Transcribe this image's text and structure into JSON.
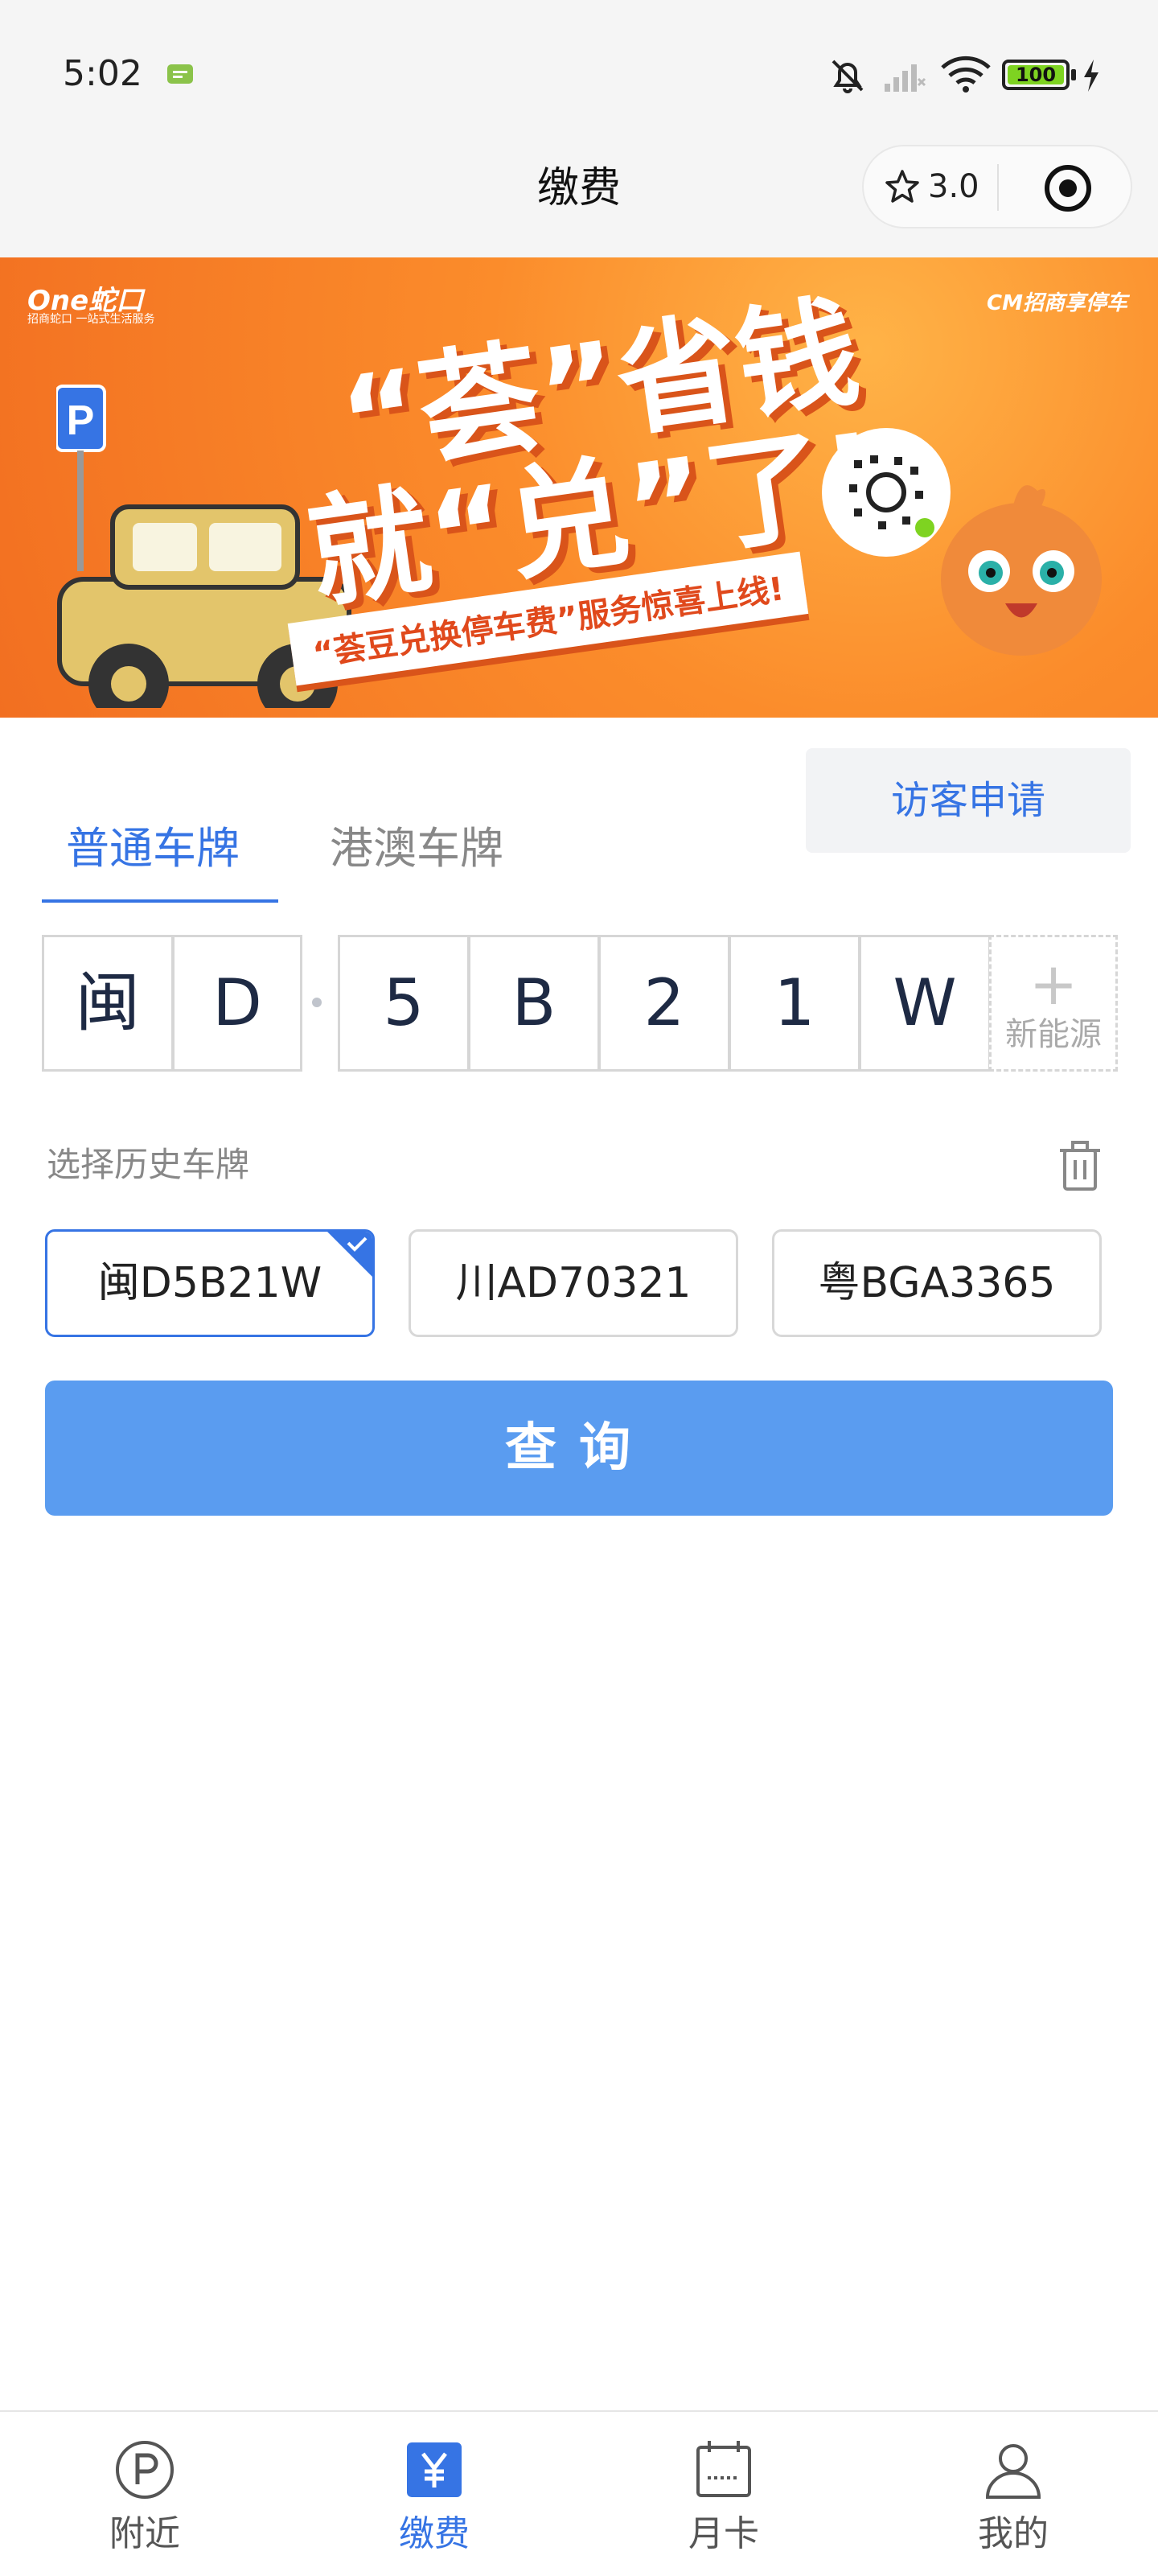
{
  "status_bar": {
    "time": "5:02",
    "battery": "100",
    "icons": [
      "message-icon",
      "mute-icon",
      "signal-icon",
      "wifi-icon",
      "battery-icon",
      "charging-icon"
    ]
  },
  "nav": {
    "title": "缴费",
    "rating": "3.0"
  },
  "banner": {
    "brand": "One蛇口",
    "brand_sub": "招商蛇口 一站式生活服务",
    "logo": "CM招商享停车",
    "headline_1": "“荟”省钱",
    "headline_2": "就“兑”了!",
    "ribbon": "“荟豆兑换停车费”服务惊喜上线!",
    "colors": {
      "bg": "#f26f21",
      "accent": "#ffb347"
    }
  },
  "plate": {
    "visitor_button": "访客申请",
    "tabs": [
      "普通车牌",
      "港澳车牌"
    ],
    "active_tab": "普通车牌",
    "chars": [
      "闽",
      "D",
      "5",
      "B",
      "2",
      "1",
      "W"
    ],
    "new_energy_plus": "+",
    "new_energy_label": "新能源"
  },
  "history": {
    "label": "选择历史车牌",
    "plates": [
      "闽D5B21W",
      "川AD70321",
      "粤BGA3365"
    ],
    "selected": "闽D5B21W"
  },
  "query_button": "查询",
  "tab_bar": {
    "items": [
      {
        "label": "附近",
        "icon": "parking-icon"
      },
      {
        "label": "缴费",
        "icon": "yuan-icon"
      },
      {
        "label": "月卡",
        "icon": "calendar-icon"
      },
      {
        "label": "我的",
        "icon": "user-icon"
      }
    ],
    "active": "缴费"
  },
  "colors": {
    "primary": "#3674e4",
    "query_button": "#5a9cf0",
    "border": "#d6d6d6"
  }
}
